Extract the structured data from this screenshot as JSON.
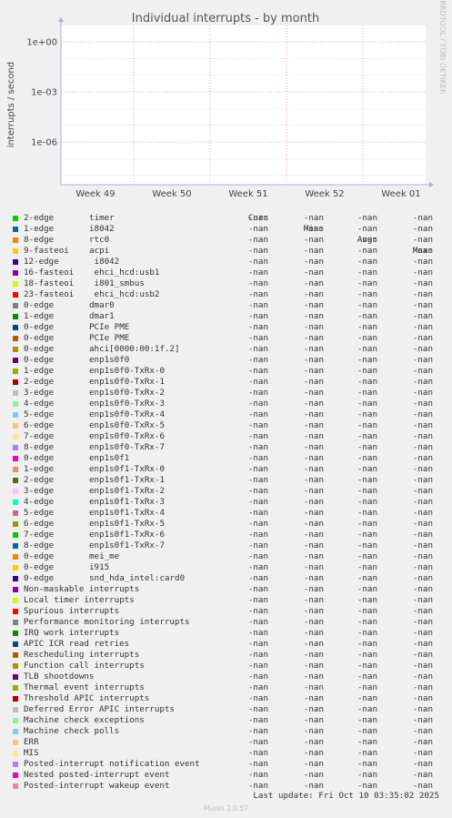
{
  "chart_data": {
    "type": "line",
    "title": "Individual interrupts - by month",
    "ylabel": "interrupts / second",
    "y_scale": "log",
    "yticks": [
      "1e+00",
      "1e-03",
      "1e-06"
    ],
    "categories": [
      "Week 49",
      "Week 50",
      "Week 51",
      "Week 52",
      "Week 01"
    ],
    "grid": true,
    "side_label": "RRDTOOL / TOBI OETIKER",
    "columns": [
      "Cur:",
      "Min:",
      "Avg:",
      "Max:"
    ],
    "series": [
      {
        "name": "2-edge",
        "device": "timer",
        "color": "#00cc00",
        "cur": "-nan",
        "min": "-nan",
        "avg": "-nan",
        "max": "-nan"
      },
      {
        "name": "1-edge",
        "device": "i8042",
        "color": "#0066b3",
        "cur": "-nan",
        "min": "-nan",
        "avg": "-nan",
        "max": "-nan"
      },
      {
        "name": "8-edge",
        "device": "rtc0",
        "color": "#ff8000",
        "cur": "-nan",
        "min": "-nan",
        "avg": "-nan",
        "max": "-nan"
      },
      {
        "name": "9-fasteoi",
        "device": "acpi",
        "color": "#ffcc00",
        "cur": "-nan",
        "min": "-nan",
        "avg": "-nan",
        "max": "-nan"
      },
      {
        "name": "12-edge",
        "device": " i8042",
        "color": "#330099",
        "cur": "-nan",
        "min": "-nan",
        "avg": "-nan",
        "max": "-nan"
      },
      {
        "name": "16-fasteoi",
        "device": " ehci_hcd:usb1",
        "color": "#990099",
        "cur": "-nan",
        "min": "-nan",
        "avg": "-nan",
        "max": "-nan"
      },
      {
        "name": "18-fasteoi",
        "device": " i801_smbus",
        "color": "#ccff00",
        "cur": "-nan",
        "min": "-nan",
        "avg": "-nan",
        "max": "-nan"
      },
      {
        "name": "23-fasteoi",
        "device": " ehci_hcd:usb2",
        "color": "#ff0000",
        "cur": "-nan",
        "min": "-nan",
        "avg": "-nan",
        "max": "-nan"
      },
      {
        "name": "0-edge",
        "device": "dmar0",
        "color": "#808080",
        "cur": "-nan",
        "min": "-nan",
        "avg": "-nan",
        "max": "-nan"
      },
      {
        "name": "1-edge",
        "device": "dmar1",
        "color": "#008f00",
        "cur": "-nan",
        "min": "-nan",
        "avg": "-nan",
        "max": "-nan"
      },
      {
        "name": "0-edge",
        "device": "PCIe PME",
        "color": "#00487d",
        "cur": "-nan",
        "min": "-nan",
        "avg": "-nan",
        "max": "-nan"
      },
      {
        "name": "0-edge",
        "device": "PCIe PME",
        "color": "#b35a00",
        "cur": "-nan",
        "min": "-nan",
        "avg": "-nan",
        "max": "-nan"
      },
      {
        "name": "0-edge",
        "device": "ahci[0000:00:1f.2]",
        "color": "#b38f00",
        "cur": "-nan",
        "min": "-nan",
        "avg": "-nan",
        "max": "-nan"
      },
      {
        "name": "0-edge",
        "device": "enp1s0f0",
        "color": "#6b006b",
        "cur": "-nan",
        "min": "-nan",
        "avg": "-nan",
        "max": "-nan"
      },
      {
        "name": "1-edge",
        "device": "enp1s0f0-TxRx-0",
        "color": "#8fb300",
        "cur": "-nan",
        "min": "-nan",
        "avg": "-nan",
        "max": "-nan"
      },
      {
        "name": "2-edge",
        "device": "enp1s0f0-TxRx-1",
        "color": "#b30000",
        "cur": "-nan",
        "min": "-nan",
        "avg": "-nan",
        "max": "-nan"
      },
      {
        "name": "3-edge",
        "device": "enp1s0f0-TxRx-2",
        "color": "#bebebe",
        "cur": "-nan",
        "min": "-nan",
        "avg": "-nan",
        "max": "-nan"
      },
      {
        "name": "4-edge",
        "device": "enp1s0f0-TxRx-3",
        "color": "#80ff80",
        "cur": "-nan",
        "min": "-nan",
        "avg": "-nan",
        "max": "-nan"
      },
      {
        "name": "5-edge",
        "device": "enp1s0f0-TxRx-4",
        "color": "#80c9ff",
        "cur": "-nan",
        "min": "-nan",
        "avg": "-nan",
        "max": "-nan"
      },
      {
        "name": "6-edge",
        "device": "enp1s0f0-TxRx-5",
        "color": "#ffc080",
        "cur": "-nan",
        "min": "-nan",
        "avg": "-nan",
        "max": "-nan"
      },
      {
        "name": "7-edge",
        "device": "enp1s0f0-TxRx-6",
        "color": "#ffe680",
        "cur": "-nan",
        "min": "-nan",
        "avg": "-nan",
        "max": "-nan"
      },
      {
        "name": "8-edge",
        "device": "enp1s0f0-TxRx-7",
        "color": "#aa80ff",
        "cur": "-nan",
        "min": "-nan",
        "avg": "-nan",
        "max": "-nan"
      },
      {
        "name": "0-edge",
        "device": "enp1s0f1",
        "color": "#ee00cc",
        "cur": "-nan",
        "min": "-nan",
        "avg": "-nan",
        "max": "-nan"
      },
      {
        "name": "1-edge",
        "device": "enp1s0f1-TxRx-0",
        "color": "#ff8080",
        "cur": "-nan",
        "min": "-nan",
        "avg": "-nan",
        "max": "-nan"
      },
      {
        "name": "2-edge",
        "device": "enp1s0f1-TxRx-1",
        "color": "#666600",
        "cur": "-nan",
        "min": "-nan",
        "avg": "-nan",
        "max": "-nan"
      },
      {
        "name": "3-edge",
        "device": "enp1s0f1-TxRx-2",
        "color": "#ffbfff",
        "cur": "-nan",
        "min": "-nan",
        "avg": "-nan",
        "max": "-nan"
      },
      {
        "name": "4-edge",
        "device": "enp1s0f1-TxRx-3",
        "color": "#00ffcc",
        "cur": "-nan",
        "min": "-nan",
        "avg": "-nan",
        "max": "-nan"
      },
      {
        "name": "5-edge",
        "device": "enp1s0f1-TxRx-4",
        "color": "#cc6699",
        "cur": "-nan",
        "min": "-nan",
        "avg": "-nan",
        "max": "-nan"
      },
      {
        "name": "6-edge",
        "device": "enp1s0f1-TxRx-5",
        "color": "#999900",
        "cur": "-nan",
        "min": "-nan",
        "avg": "-nan",
        "max": "-nan"
      },
      {
        "name": "7-edge",
        "device": "enp1s0f1-TxRx-6",
        "color": "#00cc00",
        "cur": "-nan",
        "min": "-nan",
        "avg": "-nan",
        "max": "-nan"
      },
      {
        "name": "8-edge",
        "device": "enp1s0f1-TxRx-7",
        "color": "#0066b3",
        "cur": "-nan",
        "min": "-nan",
        "avg": "-nan",
        "max": "-nan"
      },
      {
        "name": "0-edge",
        "device": "mei_me",
        "color": "#ff8000",
        "cur": "-nan",
        "min": "-nan",
        "avg": "-nan",
        "max": "-nan"
      },
      {
        "name": "0-edge",
        "device": "i915",
        "color": "#ffcc00",
        "cur": "-nan",
        "min": "-nan",
        "avg": "-nan",
        "max": "-nan"
      },
      {
        "name": "0-edge",
        "device": "snd_hda_intel:card0",
        "color": "#330099",
        "cur": "-nan",
        "min": "-nan",
        "avg": "-nan",
        "max": "-nan"
      },
      {
        "name": "Non-maskable interrupts",
        "device": "",
        "color": "#990099",
        "cur": "-nan",
        "min": "-nan",
        "avg": "-nan",
        "max": "-nan"
      },
      {
        "name": "Local timer interrupts",
        "device": "",
        "color": "#ccff00",
        "cur": "-nan",
        "min": "-nan",
        "avg": "-nan",
        "max": "-nan"
      },
      {
        "name": "Spurious interrupts",
        "device": "",
        "color": "#ff0000",
        "cur": "-nan",
        "min": "-nan",
        "avg": "-nan",
        "max": "-nan"
      },
      {
        "name": "Performance monitoring interrupts",
        "device": "",
        "color": "#808080",
        "cur": "-nan",
        "min": "-nan",
        "avg": "-nan",
        "max": "-nan"
      },
      {
        "name": "IRQ work interrupts",
        "device": "",
        "color": "#008f00",
        "cur": "-nan",
        "min": "-nan",
        "avg": "-nan",
        "max": "-nan"
      },
      {
        "name": "APIC ICR read retries",
        "device": "",
        "color": "#00487d",
        "cur": "-nan",
        "min": "-nan",
        "avg": "-nan",
        "max": "-nan"
      },
      {
        "name": "Rescheduling interrupts",
        "device": "",
        "color": "#b35a00",
        "cur": "-nan",
        "min": "-nan",
        "avg": "-nan",
        "max": "-nan"
      },
      {
        "name": "Function call interrupts",
        "device": "",
        "color": "#b38f00",
        "cur": "-nan",
        "min": "-nan",
        "avg": "-nan",
        "max": "-nan"
      },
      {
        "name": "TLB shootdowns",
        "device": "",
        "color": "#6b006b",
        "cur": "-nan",
        "min": "-nan",
        "avg": "-nan",
        "max": "-nan"
      },
      {
        "name": "Thermal event interrupts",
        "device": "",
        "color": "#8fb300",
        "cur": "-nan",
        "min": "-nan",
        "avg": "-nan",
        "max": "-nan"
      },
      {
        "name": "Threshold APIC interrupts",
        "device": "",
        "color": "#b30000",
        "cur": "-nan",
        "min": "-nan",
        "avg": "-nan",
        "max": "-nan"
      },
      {
        "name": "Deferred Error APIC interrupts",
        "device": "",
        "color": "#bebebe",
        "cur": "-nan",
        "min": "-nan",
        "avg": "-nan",
        "max": "-nan"
      },
      {
        "name": "Machine check exceptions",
        "device": "",
        "color": "#80ff80",
        "cur": "-nan",
        "min": "-nan",
        "avg": "-nan",
        "max": "-nan"
      },
      {
        "name": "Machine check polls",
        "device": "",
        "color": "#80c9ff",
        "cur": "-nan",
        "min": "-nan",
        "avg": "-nan",
        "max": "-nan"
      },
      {
        "name": "ERR",
        "device": "",
        "color": "#ffc080",
        "cur": "-nan",
        "min": "-nan",
        "avg": "-nan",
        "max": "-nan"
      },
      {
        "name": "MIS",
        "device": "",
        "color": "#ffe680",
        "cur": "-nan",
        "min": "-nan",
        "avg": "-nan",
        "max": "-nan"
      },
      {
        "name": "Posted-interrupt notification event",
        "device": "",
        "color": "#aa80ff",
        "cur": "-nan",
        "min": "-nan",
        "avg": "-nan",
        "max": "-nan"
      },
      {
        "name": "Nested posted-interrupt event",
        "device": "",
        "color": "#ee00cc",
        "cur": "-nan",
        "min": "-nan",
        "avg": "-nan",
        "max": "-nan"
      },
      {
        "name": "Posted-interrupt wakeup event",
        "device": "",
        "color": "#ff8080",
        "cur": "-nan",
        "min": "-nan",
        "avg": "-nan",
        "max": "-nan"
      }
    ]
  },
  "footer": {
    "last_update": "Last update: Fri Oct 10 03:35:02 2025",
    "version": "Munin 2.0.57"
  }
}
